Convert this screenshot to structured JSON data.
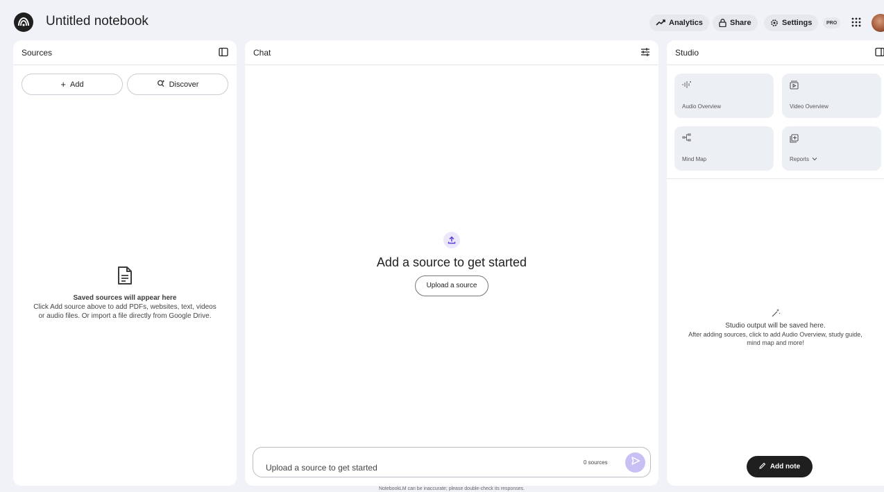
{
  "header": {
    "title": "Untitled notebook",
    "analytics_label": "Analytics",
    "share_label": "Share",
    "settings_label": "Settings",
    "pro_badge": "PRO"
  },
  "sources": {
    "title": "Sources",
    "add_label": "Add",
    "discover_label": "Discover",
    "empty_title": "Saved sources will appear here",
    "empty_line1": "Click Add source above to add PDFs, websites, text, videos",
    "empty_line2": "or audio files. Or import a file directly from Google Drive."
  },
  "chat": {
    "title": "Chat",
    "empty_title": "Add a source to get started",
    "upload_button": "Upload a source",
    "input_placeholder": "Upload a source to get started",
    "source_count": "0 sources"
  },
  "studio": {
    "title": "Studio",
    "tiles": [
      {
        "label": "Audio Overview",
        "icon": "audio-waveform-icon"
      },
      {
        "label": "Video Overview",
        "icon": "video-icon"
      },
      {
        "label": "Mind Map",
        "icon": "mind-map-icon"
      },
      {
        "label": "Reports",
        "icon": "reports-icon"
      }
    ],
    "empty_title": "Studio output will be saved here.",
    "empty_line1": "After adding sources, click to add Audio Overview, study guide,",
    "empty_line2": "mind map and more!",
    "add_note_label": "Add note"
  },
  "footer": {
    "disclaimer": "NotebookLM can be inaccurate; please double-check its responses."
  },
  "colors": {
    "background": "#f0f2f7",
    "panel": "#ffffff",
    "accent_send": "#c8bff5",
    "dark_button": "#1f1f1f"
  }
}
